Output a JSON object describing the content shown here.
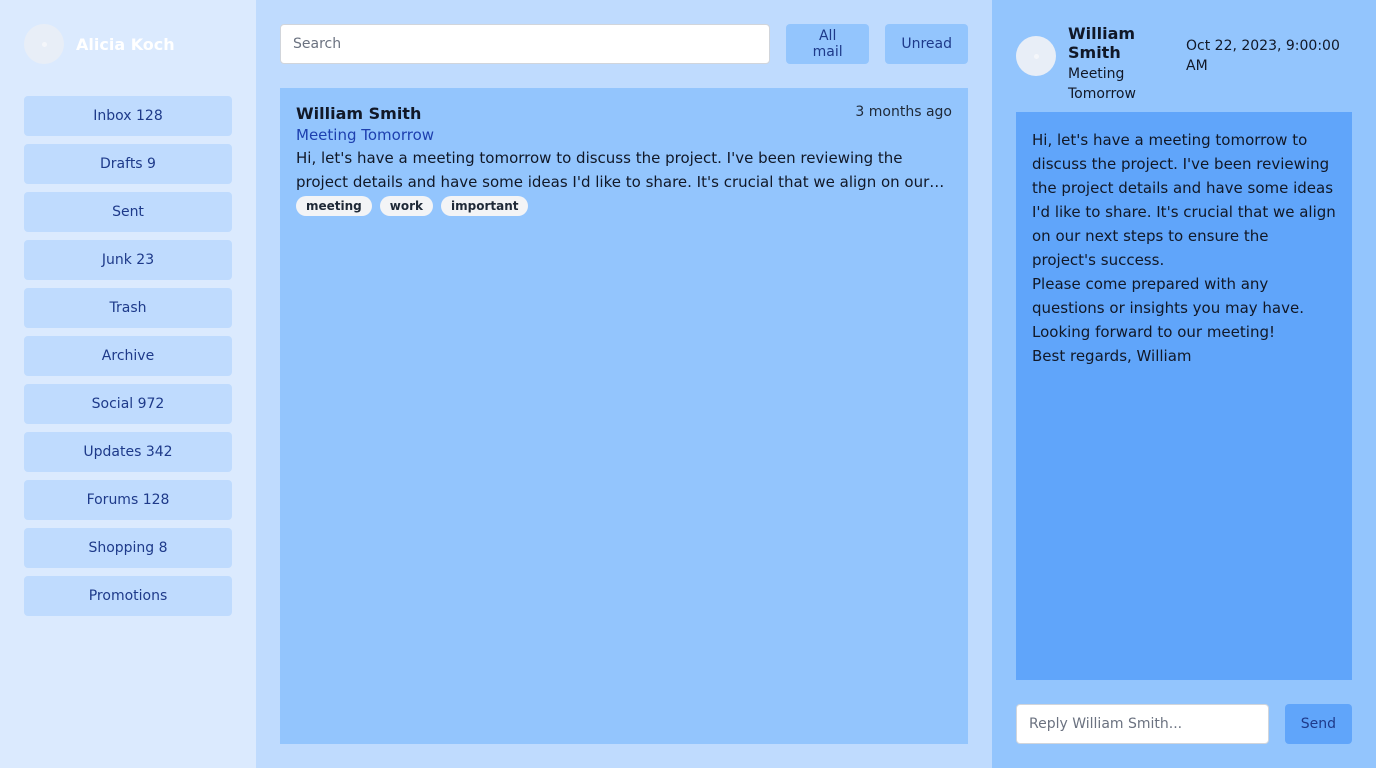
{
  "user": {
    "name": "Alicia Koch",
    "avatar_icon": "avatar-placeholder-icon"
  },
  "sidebar": {
    "items": [
      {
        "label": "Inbox 128"
      },
      {
        "label": "Drafts 9"
      },
      {
        "label": "Sent"
      },
      {
        "label": "Junk 23"
      },
      {
        "label": "Trash"
      },
      {
        "label": "Archive"
      },
      {
        "label": "Social 972"
      },
      {
        "label": "Updates 342"
      },
      {
        "label": "Forums 128"
      },
      {
        "label": "Shopping 8"
      },
      {
        "label": "Promotions"
      }
    ]
  },
  "toolbar": {
    "search_placeholder": "Search",
    "all_mail_label": "All mail",
    "unread_label": "Unread"
  },
  "mail_list": [
    {
      "from": "William Smith",
      "time": "3 months ago",
      "subject": "Meeting Tomorrow",
      "preview": "Hi, let's have a meeting tomorrow to discuss the project. I've been reviewing the project details and have some ideas I'd like to share. It's crucial that we align on our next steps to ensure the project's success.",
      "tags": [
        "meeting",
        "work",
        "important"
      ]
    }
  ],
  "reader": {
    "from": "William Smith",
    "subject": "Meeting Tomorrow",
    "date": "Oct 22, 2023, 9:00:00 AM",
    "body": [
      "Hi, let's have a meeting tomorrow to discuss the project. I've been reviewing the project details and have some ideas I'd like to share. It's crucial that we align on our next steps to ensure the project's success.",
      "Please come prepared with any questions or insights you may have.",
      "Looking forward to our meeting!",
      "Best regards, William"
    ],
    "reply_placeholder": "Reply William Smith...",
    "send_label": "Send"
  },
  "colors": {
    "sidebar_bg": "#dbeafe",
    "panel_bg": "#bfdbfe",
    "list_bg": "#93c5fd",
    "reader_body_bg": "#60a5fa"
  }
}
